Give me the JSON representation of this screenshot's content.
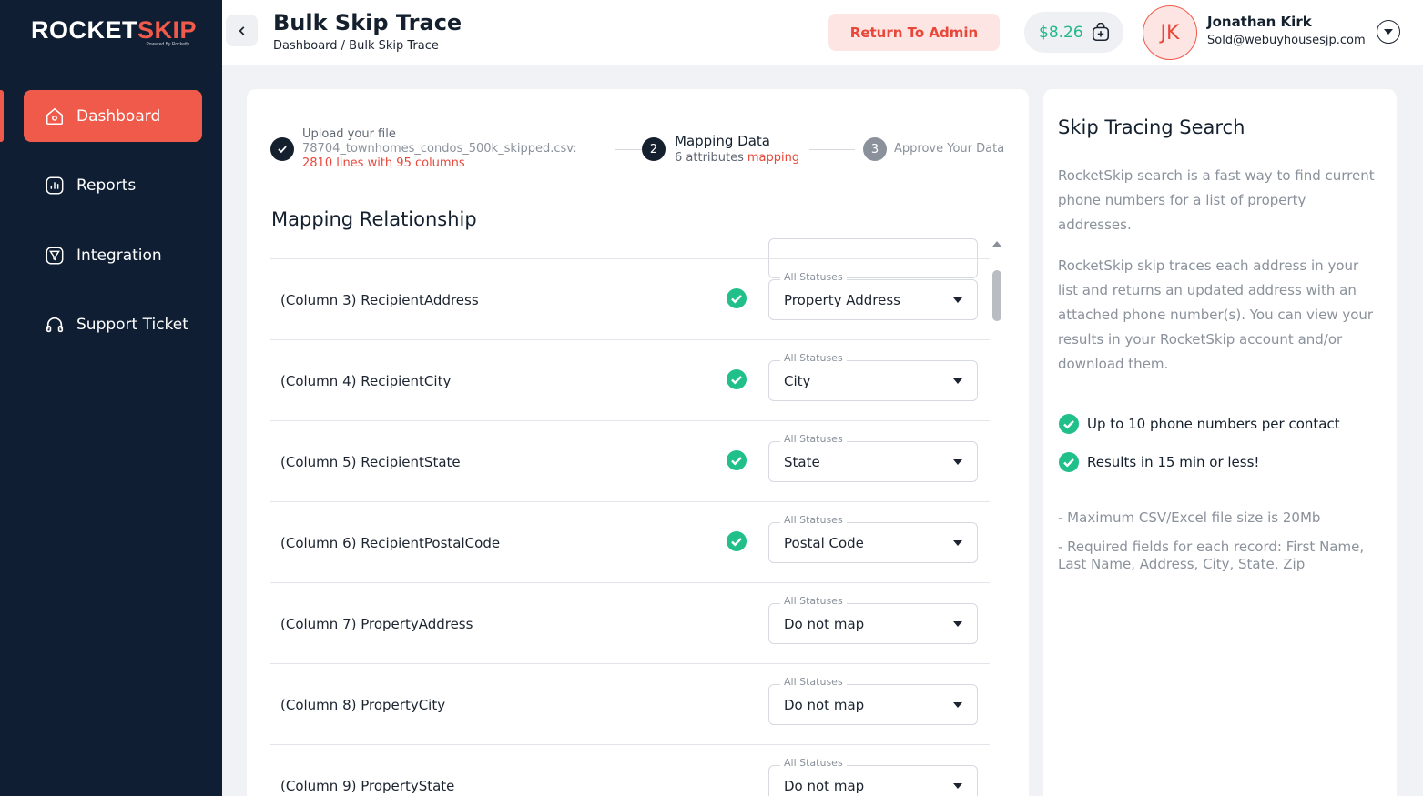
{
  "brand": {
    "name_part1": "ROCKET",
    "name_part2": "SKIP",
    "powered_by": "Powered By Rocketly"
  },
  "sidebar": {
    "items": [
      {
        "label": "Dashboard",
        "icon": "home-icon",
        "active": true
      },
      {
        "label": "Reports",
        "icon": "reports-icon",
        "active": false
      },
      {
        "label": "Integration",
        "icon": "integration-icon",
        "active": false
      },
      {
        "label": "Support Ticket",
        "icon": "headset-icon",
        "active": false
      }
    ]
  },
  "header": {
    "title": "Bulk Skip Trace",
    "breadcrumb": "Dashboard / Bulk Skip Trace",
    "return_button": "Return To Admin",
    "balance": "$8.26",
    "user": {
      "initials": "JK",
      "name": "Jonathan Kirk",
      "email": "Sold@webuyhousesjp.com"
    }
  },
  "stepper": {
    "step1": {
      "title": "Upload your file",
      "file": "78704_townhomes_condos_500k_skipped.csv:",
      "lines": "2810 lines with 95 columns"
    },
    "step2": {
      "number": "2",
      "title": "Mapping Data",
      "attributes": "6 attributes",
      "accent": "mapping"
    },
    "step3": {
      "number": "3",
      "title": "Approve Your Data"
    }
  },
  "mapping": {
    "title": "Mapping Relationship",
    "legend": "All Statuses",
    "rows": [
      {
        "label": "(Column 3) RecipientAddress",
        "mapped": true,
        "value": "Property Address"
      },
      {
        "label": "(Column 4) RecipientCity",
        "mapped": true,
        "value": "City"
      },
      {
        "label": "(Column 5) RecipientState",
        "mapped": true,
        "value": "State"
      },
      {
        "label": "(Column 6) RecipientPostalCode",
        "mapped": true,
        "value": "Postal Code"
      },
      {
        "label": "(Column 7) PropertyAddress",
        "mapped": false,
        "value": "Do not map"
      },
      {
        "label": "(Column 8) PropertyCity",
        "mapped": false,
        "value": "Do not map"
      },
      {
        "label": "(Column 9) PropertyState",
        "mapped": false,
        "value": "Do not map"
      }
    ]
  },
  "info": {
    "title": "Skip Tracing Search",
    "paragraph1": "RocketSkip search is a fast way to find current phone numbers for a list of property addresses.",
    "paragraph2": "RocketSkip skip traces each address in your list and returns an updated address with an attached phone number(s). You can view your results in your RocketSkip account and/or download them.",
    "features": [
      "Up to 10 phone numbers per contact",
      "Results in 15 min or less!"
    ],
    "notes": [
      "- Maximum CSV/Excel file size is 20Mb",
      "- Required fields for each record: First Name, Last Name, Address, City, State, Zip"
    ]
  },
  "colors": {
    "sidebar_bg": "#0f1e33",
    "accent": "#f05a4a",
    "success": "#21c08b",
    "balance_text": "#21b88a"
  }
}
